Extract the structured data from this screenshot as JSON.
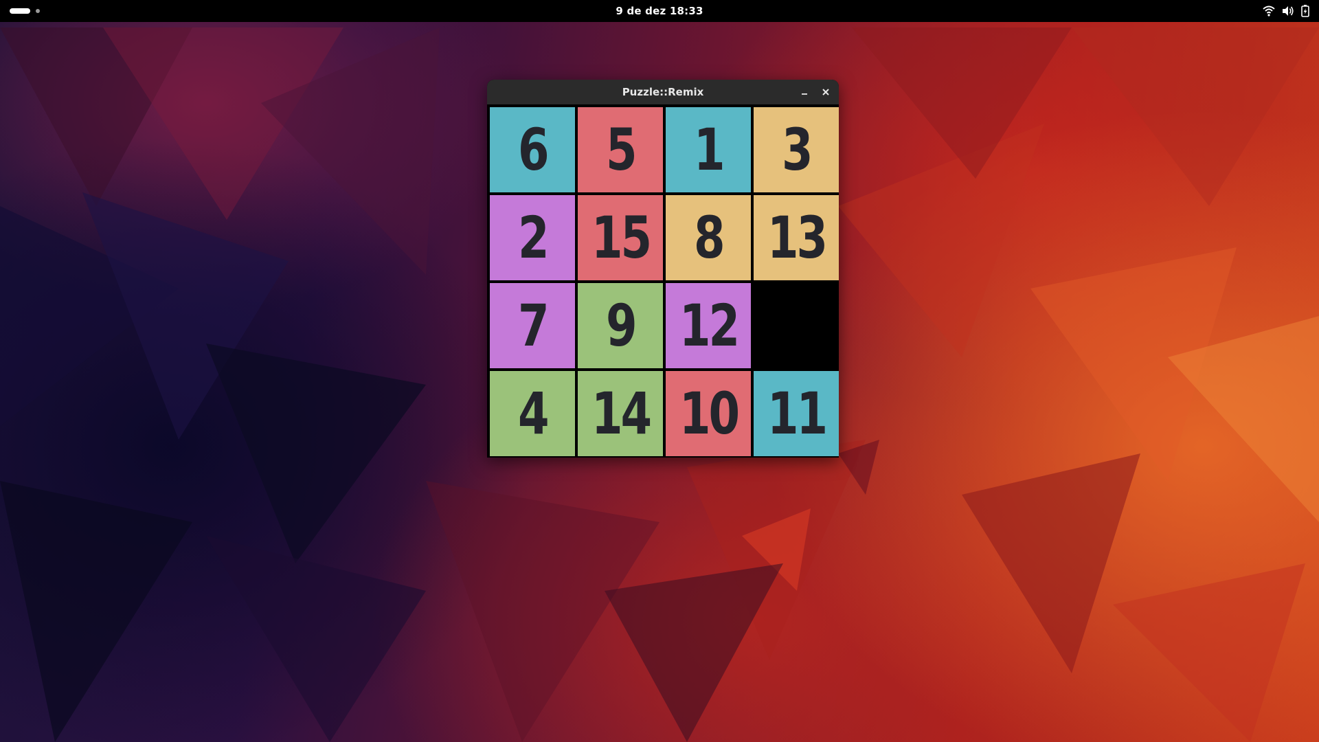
{
  "topbar": {
    "clock": "9 de dez  18:33",
    "icons": [
      "wifi-icon",
      "volume-icon",
      "battery-icon"
    ]
  },
  "window": {
    "title": "Puzzle::Remix",
    "buttons": [
      "minimize-icon",
      "close-icon"
    ]
  },
  "colors": {
    "teal": "#5ab8c6",
    "red": "#e06c73",
    "sand": "#e6c17c",
    "purple": "#c57ad9",
    "green": "#9bc27a",
    "digits": "#24252c",
    "empty": "#000000"
  },
  "board": {
    "rows": 4,
    "cols": 4,
    "tiles": [
      {
        "label": "6",
        "color": "#5ab8c6"
      },
      {
        "label": "5",
        "color": "#e06c73"
      },
      {
        "label": "1",
        "color": "#5ab8c6"
      },
      {
        "label": "3",
        "color": "#e6c17c"
      },
      {
        "label": "2",
        "color": "#c57ad9"
      },
      {
        "label": "15",
        "color": "#e06c73"
      },
      {
        "label": "8",
        "color": "#e6c17c"
      },
      {
        "label": "13",
        "color": "#e6c17c"
      },
      {
        "label": "7",
        "color": "#c57ad9"
      },
      {
        "label": "9",
        "color": "#9bc27a"
      },
      {
        "label": "12",
        "color": "#c57ad9"
      },
      {
        "label": "",
        "color": "#000000",
        "empty": true
      },
      {
        "label": "4",
        "color": "#9bc27a"
      },
      {
        "label": "14",
        "color": "#9bc27a"
      },
      {
        "label": "10",
        "color": "#e06c73"
      },
      {
        "label": "11",
        "color": "#5ab8c6"
      }
    ]
  }
}
